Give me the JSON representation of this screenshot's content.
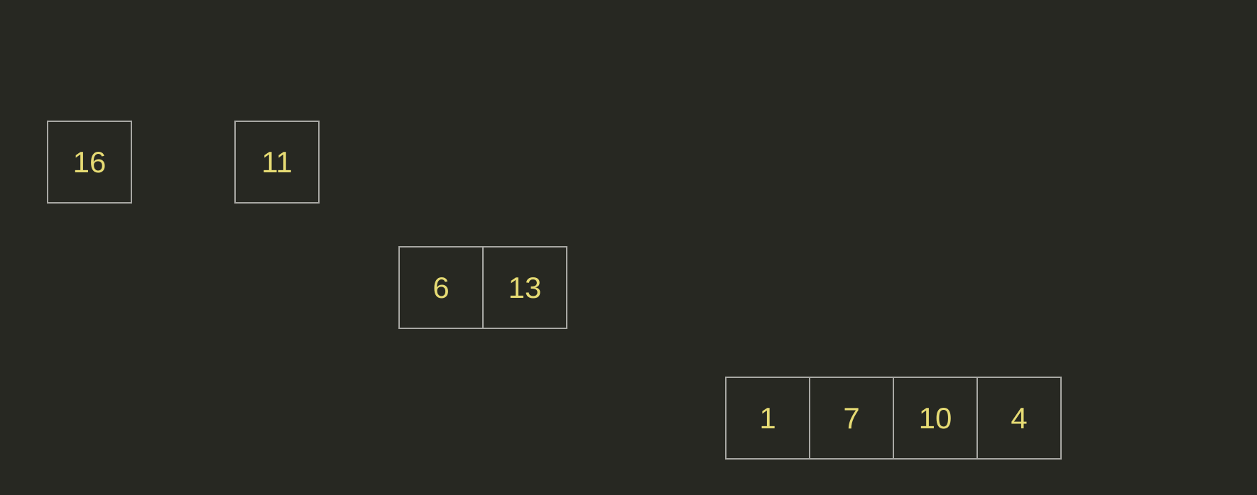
{
  "groups": [
    {
      "cells": [
        "16"
      ]
    },
    {
      "cells": [
        "11"
      ]
    },
    {
      "cells": [
        "6",
        "13"
      ]
    },
    {
      "cells": [
        "1",
        "7",
        "10",
        "4"
      ]
    }
  ],
  "colors": {
    "background": "#272822",
    "cell_border": "#a8a8a4",
    "cell_text": "#e6db74"
  }
}
